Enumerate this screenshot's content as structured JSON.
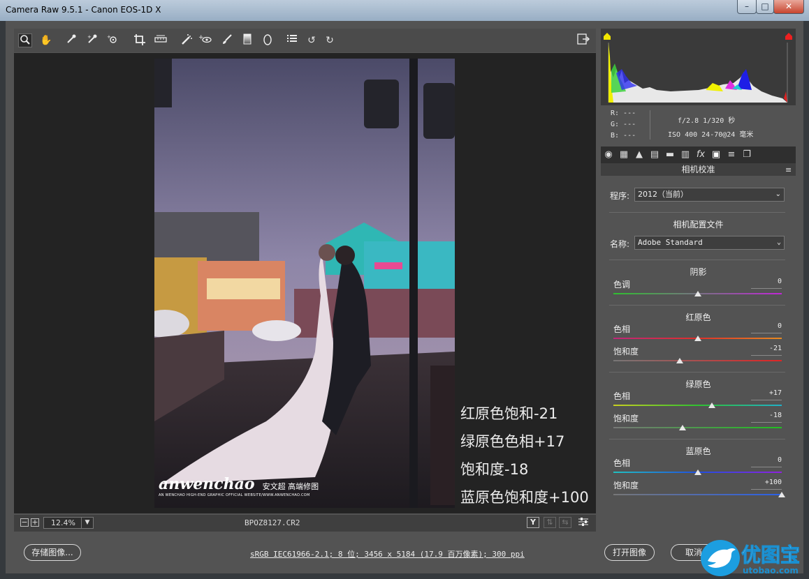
{
  "window": {
    "title": "Camera Raw 9.5.1 -  Canon EOS-1D X"
  },
  "toolbar": {
    "tools": [
      "zoom-tool",
      "hand-tool",
      "white-balance-tool",
      "color-sampler-tool",
      "targeted-adjustment-tool",
      "crop-tool",
      "straighten-tool",
      "spot-removal-tool",
      "red-eye-tool",
      "adjustment-brush",
      "graduated-filter",
      "radial-filter",
      "preferences",
      "rotate-ccw",
      "rotate-cw"
    ]
  },
  "photo": {
    "watermark_logo": "anwenchao",
    "watermark_cn": "安文超 高端修图",
    "watermark_url": "AN WENCHAO HIGH-END GRAPHIC OFFICIAL WEBSITE/WWW.ANWENCHAO.COM"
  },
  "overlay": {
    "lines": [
      "红原色饱和-21",
      "绿原色色相+17",
      "饱和度-18",
      "蓝原色饱和度+100"
    ]
  },
  "status": {
    "zoom": "12.4%",
    "zoom_out": "−",
    "zoom_in": "+",
    "filename": "BPOZ8127.CR2"
  },
  "histogram": {
    "readout": {
      "r": "R:  ---",
      "g": "G:  ---",
      "b": "B:  ---",
      "exposure": "f/2.8   1/320 秒",
      "iso": "ISO 400   24-70@24 毫米"
    }
  },
  "panel": {
    "title": "相机校准",
    "process_label": "程序:",
    "process_value": "2012（当前）",
    "profile_header": "相机配置文件",
    "name_label": "名称:",
    "name_value": "Adobe Standard",
    "shadows": {
      "header": "阴影",
      "tint_label": "色调",
      "tint_value": "0"
    },
    "red": {
      "header": "红原色",
      "hue_label": "色相",
      "hue_value": "0",
      "sat_label": "饱和度",
      "sat_value": "-21"
    },
    "green": {
      "header": "绿原色",
      "hue_label": "色相",
      "hue_value": "+17",
      "sat_label": "饱和度",
      "sat_value": "-18"
    },
    "blue": {
      "header": "蓝原色",
      "hue_label": "色相",
      "hue_value": "0",
      "sat_label": "饱和度",
      "sat_value": "+100"
    }
  },
  "sliders": {
    "shadows_tint": 0,
    "red_hue": 0,
    "red_sat": -21,
    "green_hue": 17,
    "green_sat": -18,
    "blue_hue": 0,
    "blue_sat": 100
  },
  "bottom": {
    "save_label": "存储图像...",
    "info_link": "sRGB IEC61966-2.1; 8 位; 3456 x 5184 (17.9 百万像素); 300 ppi",
    "open_label": "打开图像",
    "cancel_label": "取消"
  },
  "site_watermark": {
    "name": "优图宝",
    "url": "utobao.com"
  },
  "colors": {
    "accent": "#1c9ee0",
    "panel": "#535353",
    "canvas": "#232323"
  }
}
